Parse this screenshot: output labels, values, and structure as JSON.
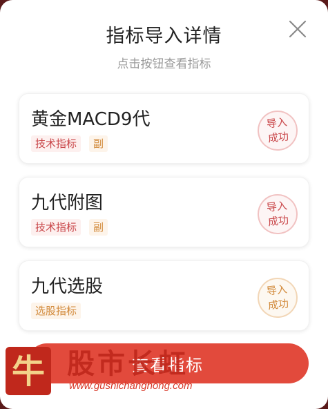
{
  "dialog": {
    "title": "指标导入详情",
    "subtitle": "点击按钮查看指标"
  },
  "items": [
    {
      "name": "黄金MACD9代",
      "tags": [
        "技术指标",
        "副"
      ],
      "status_line1": "导入",
      "status_line2": "成功"
    },
    {
      "name": "九代附图",
      "tags": [
        "技术指标",
        "副"
      ],
      "status_line1": "导入",
      "status_line2": "成功"
    },
    {
      "name": "九代选股",
      "tags": [
        "选股指标"
      ],
      "status_line1": "导入",
      "status_line2": "成功"
    }
  ],
  "cta": {
    "label": "查看指标"
  },
  "watermark": {
    "logo_char": "牛",
    "text": "股市长虹",
    "url": "www.gushichanghong.com"
  },
  "colors": {
    "accent": "#e24a3c",
    "tag_red": "#c9474a",
    "tag_orange": "#d28a3b"
  }
}
